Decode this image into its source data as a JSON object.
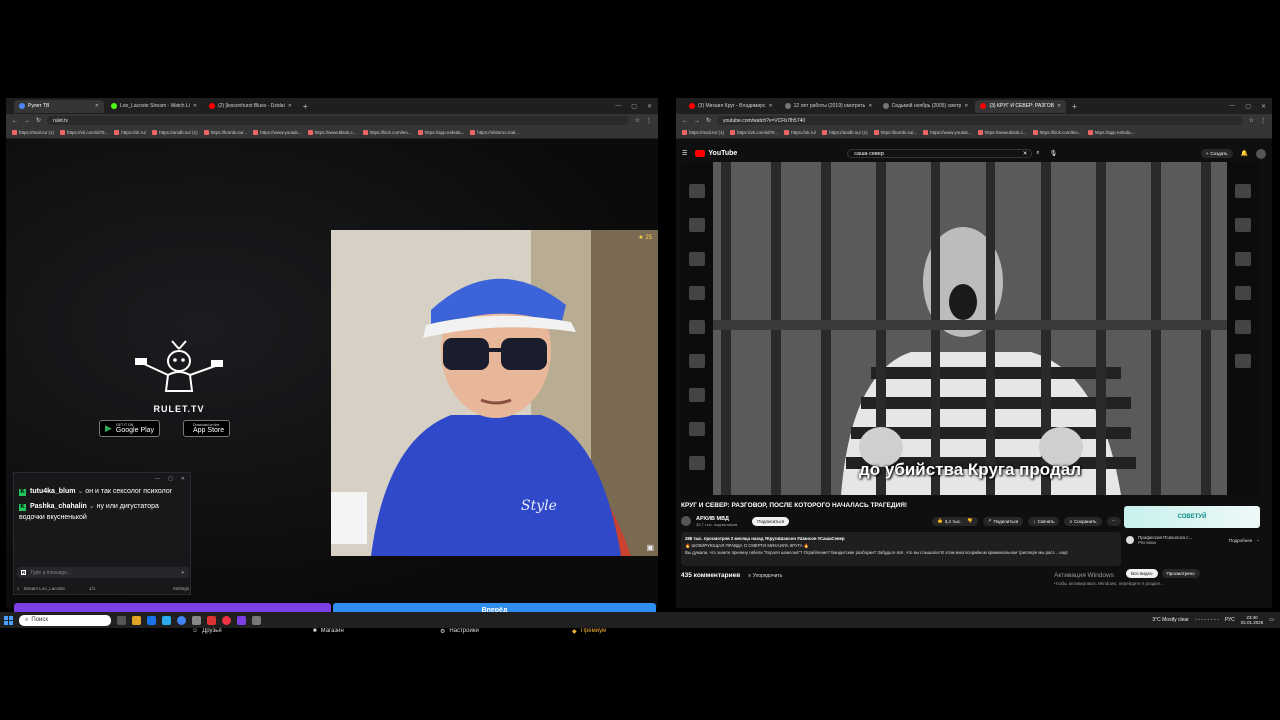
{
  "left_browser": {
    "tabs": [
      {
        "label": "Рулет ТВ",
        "active": true,
        "color": "#4f86f7"
      },
      {
        "label": "Loo_Lacoste Stream - Watch Li",
        "active": false,
        "color": "#53fc18"
      },
      {
        "label": "(2) [lessonhurst Blues - Dzidai",
        "active": false,
        "color": "#ff0000"
      }
    ],
    "url": "rulet.tv",
    "bookmarks": [
      "https://mail.ru/ (1)",
      "https://vk.com/id78...",
      "https://ok.ru/",
      "https://anidb.su/ (1)",
      "https://kombi.su/...",
      "https://www.youtub...",
      "https://www.tiktok.c...",
      "https://kick.com/leo...",
      "https://app.nebula...",
      "https://shimroo.mal..."
    ]
  },
  "rulet": {
    "logo_text": "RULET.TV",
    "google_play_small": "GET IT ON",
    "google_play": "Google Play",
    "app_store_small": "Download on the",
    "app_store": "App Store",
    "cam_badge": "25",
    "blue_button": "Вперёд",
    "nav": {
      "friends": "Друзья",
      "shop": "Магазин",
      "settings": "Настройки",
      "premium": "Премиум"
    }
  },
  "chat": {
    "messages": [
      {
        "user": "tutu4ka_blum",
        "text": "он и так сексолог психолог"
      },
      {
        "user": "Pashka_chahalin",
        "text": "ну или дигустатора водочки вкусненькой"
      }
    ],
    "input_placeholder": "Type a message...",
    "footer_channel": "Stream Loo_Lacoste",
    "footer_count": "1/1",
    "footer_extra": "Settings"
  },
  "right_browser": {
    "tabs": [
      {
        "label": "(3) Михаил Круг - Владимирс",
        "active": false,
        "color": "#ff0000"
      },
      {
        "label": "12 лет работы (2019) смотреть",
        "active": false,
        "color": "#777777"
      },
      {
        "label": "Седьмой ноябрь (2005) смотр",
        "active": false,
        "color": "#777777"
      },
      {
        "label": "(3) КРУГ И СЕВЕР: РАЗГОВ",
        "active": true,
        "color": "#ff0000"
      }
    ],
    "url": "youtube.com/watch?v=VCFb7fh5740",
    "bookmarks": [
      "https://mail.ru/ (1)",
      "https://vk.com/id78...",
      "https://ok.ru/",
      "https://anidb.su/ (1)",
      "https://kombi.su/...",
      "https://www.youtub...",
      "https://www.tiktok.c...",
      "https://kick.com/leo...",
      "https://app.nebula..."
    ]
  },
  "youtube": {
    "logo": "YouTube",
    "search_value": "саша север",
    "create_label": "Создать",
    "subtitle": "до убийства Круга продал",
    "video_title": "КРУГ И СЕВЕР: РАЗГОВОР, ПОСЛЕ КОТОРОГО НАЧАЛАСЬ ТРАГЕДИЯ!",
    "channel_name": "АРХИВ МВД",
    "channel_subs": "35,7 тыс. подписчиков",
    "subscribe": "Подписаться",
    "likes": "3,4 тыс.",
    "share": "Поделиться",
    "download": "Скачать",
    "save": "Сохранить",
    "desc_stats": "288 тыс. просмотров  2 месяца назад  #КругиШансон #Шансон #СашаСевер",
    "desc_line1": "🔥 ШОКИРУЮЩАЯ ПРАВДА О СМЕРТИ МИХАИЛА КРУГА 🔥",
    "desc_line2": "Вы думали, что знаете причину гибели \"Короля шансона\"? Ограбление? Бандитские разборки? Забудьте всё, что вы слышали! В этом многосерийном криминальном триллере мы расс ...ещё",
    "comments_count": "435 комментариев",
    "sort_label": "Упорядочить",
    "ad_banner": "СОВЕТУЙ",
    "ad_title": "Профессия Психолога с...",
    "ad_label": "Реклама",
    "ad_button": "Подробнее",
    "chip_all": "Все видео",
    "chip_watched": "Просмотрено",
    "activate_title": "Активация Windows",
    "activate_sub": "Чтобы активировать Windows, перейдите в раздел..."
  },
  "taskbar": {
    "search_placeholder": "Поиск",
    "weather": "3°C  Mostly clear",
    "lang": "РУС",
    "time": "23:40",
    "date": "02.01.2026"
  }
}
